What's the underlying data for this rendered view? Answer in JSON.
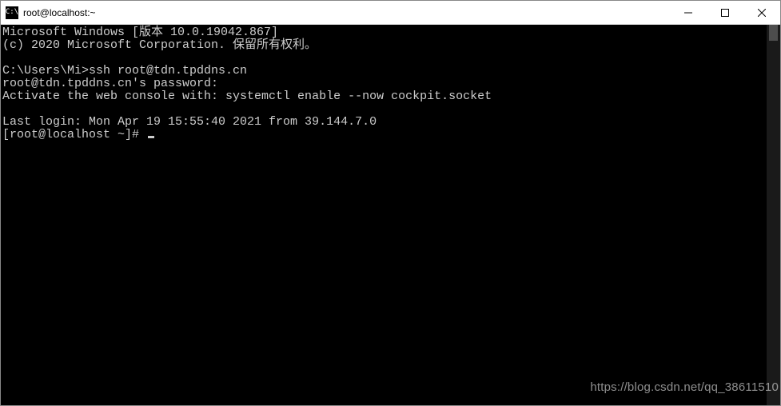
{
  "titlebar": {
    "icon_text": "C:\\",
    "title": "root@localhost:~"
  },
  "terminal": {
    "lines": [
      "Microsoft Windows [版本 10.0.19042.867]",
      "(c) 2020 Microsoft Corporation. 保留所有权利。",
      "",
      "C:\\Users\\Mi>ssh root@tdn.tpddns.cn",
      "root@tdn.tpddns.cn's password:",
      "Activate the web console with: systemctl enable --now cockpit.socket",
      "",
      "Last login: Mon Apr 19 15:55:40 2021 from 39.144.7.0"
    ],
    "prompt": "[root@localhost ~]# "
  },
  "watermark": "https://blog.csdn.net/qq_38611510"
}
